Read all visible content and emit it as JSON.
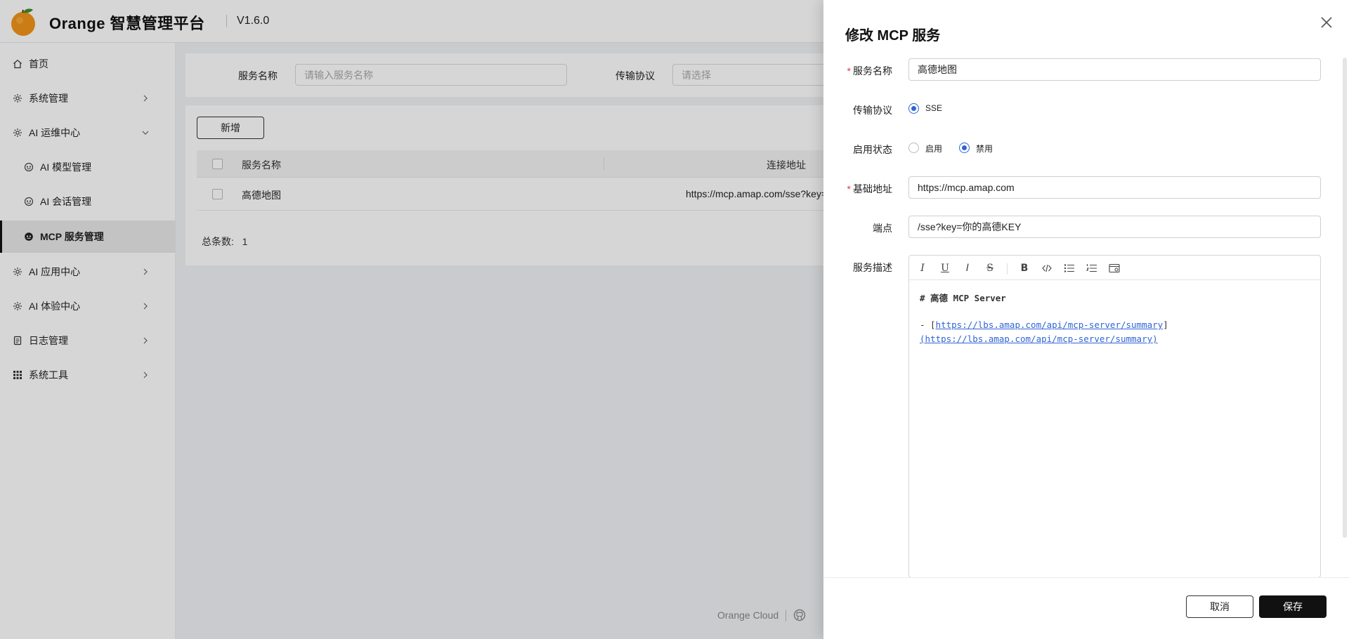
{
  "header": {
    "app_title": "Orange 智慧管理平台",
    "version": "V1.6.0"
  },
  "sidebar": {
    "items": [
      {
        "label": "首页",
        "icon": "home-icon"
      },
      {
        "label": "系统管理",
        "icon": "gear-icon"
      },
      {
        "label": "AI 运维中心",
        "icon": "gear-icon",
        "expanded": true
      },
      {
        "label": "AI 模型管理",
        "icon": "robot-icon"
      },
      {
        "label": "AI 会话管理",
        "icon": "robot-icon"
      },
      {
        "label": "MCP 服务管理",
        "icon": "robot-icon",
        "active": true
      },
      {
        "label": "AI 应用中心",
        "icon": "gear-icon"
      },
      {
        "label": "AI 体验中心",
        "icon": "gear-icon"
      },
      {
        "label": "日志管理",
        "icon": "document-icon"
      },
      {
        "label": "系统工具",
        "icon": "grid-icon"
      }
    ]
  },
  "search": {
    "name_label": "服务名称",
    "name_placeholder": "请输入服务名称",
    "protocol_label": "传输协议",
    "protocol_placeholder": "请选择"
  },
  "table": {
    "add_button": "新增",
    "columns": [
      "服务名称",
      "连接地址"
    ],
    "rows": [
      {
        "name": "高德地图",
        "url": "https://mcp.amap.com/sse?key="
      }
    ],
    "total_label": "总条数:",
    "total_value": "1"
  },
  "footer": {
    "brand": "Orange Cloud"
  },
  "drawer": {
    "title": "修改 MCP 服务",
    "fields": {
      "service_name": {
        "label": "服务名称",
        "value": "高德地图",
        "required": true
      },
      "protocol": {
        "label": "传输协议",
        "options": [
          "SSE"
        ],
        "selected": "SSE"
      },
      "status": {
        "label": "启用状态",
        "options": [
          "启用",
          "禁用"
        ],
        "selected": "禁用"
      },
      "base_url": {
        "label": "基础地址",
        "value": "https://mcp.amap.com",
        "required": true
      },
      "endpoint": {
        "label": "端点",
        "value": "/sse?key=你的高德KEY"
      },
      "description": {
        "label": "服务描述",
        "line1": "# 高德 MCP Server",
        "line2_prefix": "- [",
        "line2_link": "https://lbs.amap.com/api/mcp-server/summary",
        "line2_suffix": "]",
        "line3_prefix": "(",
        "line3_link": "https://lbs.amap.com/api/mcp-server/summary",
        "line3_suffix": ")"
      }
    },
    "cancel_label": "取消",
    "save_label": "保存"
  },
  "colors": {
    "accent": "#2f64d6",
    "primary_button": "#111111",
    "required_mark": "#ee3344"
  }
}
